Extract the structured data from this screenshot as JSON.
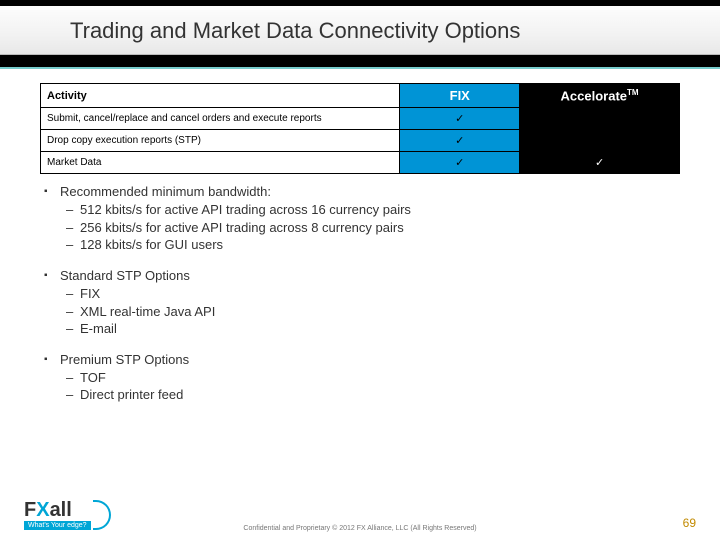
{
  "title": "Trading and Market Data Connectivity Options",
  "table": {
    "headers": {
      "activity": "Activity",
      "fix": "FIX",
      "acc_base": "Accelorate",
      "acc_tm": "TM"
    },
    "rows": [
      {
        "label": "Submit, cancel/replace and cancel orders and execute reports",
        "fix": "✓",
        "acc": ""
      },
      {
        "label": "Drop copy execution reports (STP)",
        "fix": "✓",
        "acc": ""
      },
      {
        "label": "Market Data",
        "fix": "✓",
        "acc": "✓"
      }
    ]
  },
  "bullets": [
    {
      "title": "Recommended minimum bandwidth:",
      "items": [
        "512 kbits/s for active API trading across 16 currency pairs",
        "256 kbits/s for active API trading across 8 currency pairs",
        "128 kbits/s for GUI users"
      ]
    },
    {
      "title": "Standard STP Options",
      "items": [
        "FIX",
        "XML real-time Java API",
        "E-mail"
      ]
    },
    {
      "title": "Premium STP Options",
      "items": [
        "TOF",
        "Direct printer feed"
      ]
    }
  ],
  "logo": {
    "brand_f": "F",
    "brand_x": "X",
    "brand_all": "all",
    "tagline": "What's Your edge?"
  },
  "footer": {
    "conf": "Confidential and Proprietary © 2012 FX Alliance, LLC (All Rights Reserved)",
    "page": "69"
  },
  "chart_data": {
    "type": "table",
    "columns": [
      "Activity",
      "FIX",
      "Accelorate™"
    ],
    "rows": [
      [
        "Submit, cancel/replace and cancel orders and execute reports",
        true,
        false
      ],
      [
        "Drop copy execution reports (STP)",
        true,
        false
      ],
      [
        "Market Data",
        true,
        true
      ]
    ]
  }
}
